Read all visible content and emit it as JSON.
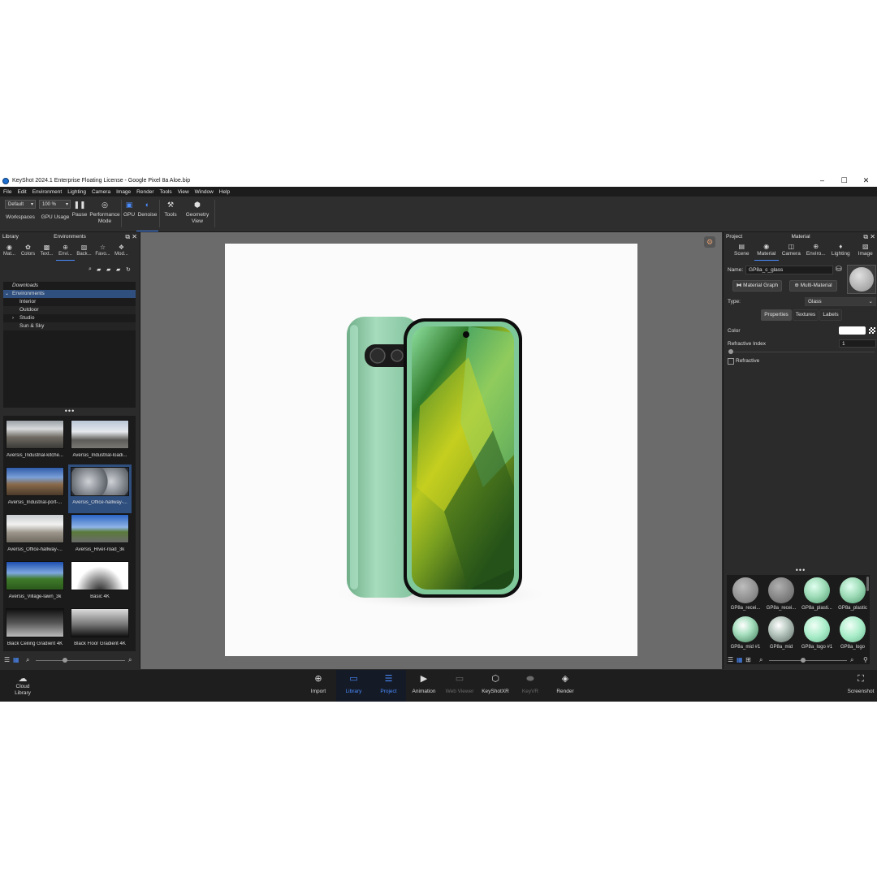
{
  "window": {
    "title": "KeyShot 2024.1 Enterprise Floating License  - Google Pixel 8a Aloe.bip",
    "controls": [
      "–",
      "☐",
      "✕"
    ]
  },
  "menu": [
    "File",
    "Edit",
    "Environment",
    "Lighting",
    "Camera",
    "Image",
    "Render",
    "Tools",
    "View",
    "Window",
    "Help"
  ],
  "toolbar": {
    "workspace_value": "Default",
    "zoom_value": "100 %",
    "workspaces_label": "Workspaces",
    "gpu_usage_label": "GPU Usage",
    "pause_label": "Pause",
    "performance_label_1": "Performance",
    "performance_label_2": "Mode",
    "gpu_label": "GPU",
    "denoise_label": "Denoise",
    "tools_label": "Tools",
    "geometry_label_1": "Geometry",
    "geometry_label_2": "View"
  },
  "library": {
    "panel_title": "Library",
    "section_title": "Environments",
    "tabs": [
      "Mat...",
      "Colors",
      "Text...",
      "Envi...",
      "Back...",
      "Favo...",
      "Mod..."
    ],
    "tree": [
      {
        "label": "Downloads",
        "italic": true
      },
      {
        "label": "Environments",
        "selected": true
      },
      {
        "label": "Interior"
      },
      {
        "label": "Outdoor"
      },
      {
        "label": "Studio"
      },
      {
        "label": "Sun & Sky"
      }
    ],
    "more_dots": "•••",
    "thumbnails": [
      {
        "label": "Aversis_Industrial-kitche..."
      },
      {
        "label": "Aversis_Industrial-loadi..."
      },
      {
        "label": "Aversis_Industrial-port-..."
      },
      {
        "label": "Aversis_Office-hallway-..."
      },
      {
        "label": "Aversis_Office-hallway-..."
      },
      {
        "label": "Aversis_River-road_3k"
      },
      {
        "label": "Aversis_Village-lawn_3k"
      },
      {
        "label": "Basic 4K"
      },
      {
        "label": "Black Ceiling Gradient 4K"
      },
      {
        "label": "Black Floor Gradient 4K"
      }
    ]
  },
  "properties": {
    "project_label": "Project",
    "panel_title": "Material",
    "tabs": [
      "Scene",
      "Material",
      "Camera",
      "Enviro...",
      "Lighting",
      "Image"
    ],
    "name_label": "Name:",
    "name_value": "GP8a_c_glass",
    "material_graph_label": "Material Graph",
    "multi_material_label": "Multi-Material",
    "type_label": "Type:",
    "type_value": "Glass",
    "subtabs": [
      "Properties",
      "Textures",
      "Labels"
    ],
    "color_label": "Color",
    "refractive_index_label": "Refractive Index",
    "refractive_index_value": "1",
    "refractive_label": "Refractive",
    "more_dots": "•••",
    "materials": [
      {
        "label": "GP8a_recei...",
        "color": "#9a9a9a"
      },
      {
        "label": "GP8a_recei...",
        "color": "#8e8e8e"
      },
      {
        "label": "GP8a_plasti...",
        "color": "#9fdcb8"
      },
      {
        "label": "GP8a_plastic",
        "color": "#9fdcb8"
      },
      {
        "label": "GP8a_mid #1",
        "color": "#a8e0c0"
      },
      {
        "label": "GP8a_mid",
        "color": "#b8c8c0"
      },
      {
        "label": "GP8a_logo #1",
        "color": "#a8ecc8"
      },
      {
        "label": "GP8a_logo",
        "color": "#a8ecc8"
      }
    ]
  },
  "bottombar": {
    "cloud_library_1": "Cloud",
    "cloud_library_2": "Library",
    "items": [
      "Import",
      "Library",
      "Project",
      "Animation",
      "Web Viewer",
      "KeyShotXR",
      "KeyVR",
      "Render"
    ],
    "screenshot_label": "Screenshot"
  },
  "colors": {
    "accent": "#4a8cff",
    "panel_bg": "#2b2b2b",
    "viewport_bg": "#6b6b6b",
    "phone_body": "#8fc9a4"
  }
}
